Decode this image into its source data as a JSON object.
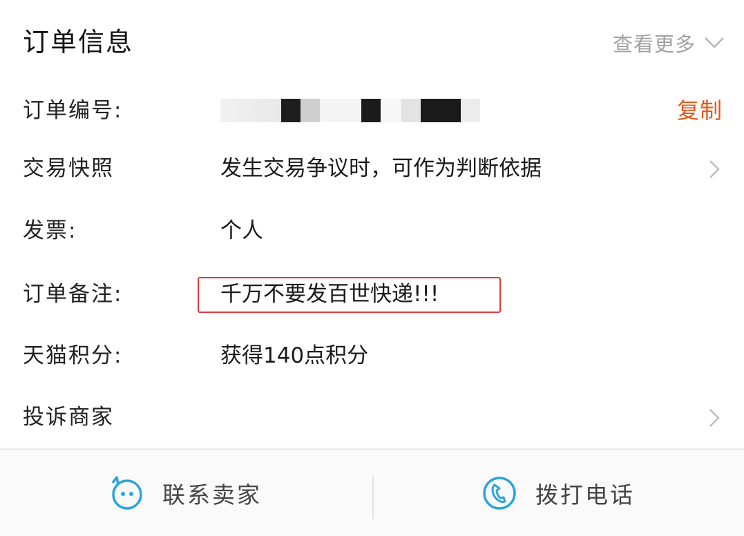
{
  "header": {
    "title": "订单信息",
    "more_label": "查看更多"
  },
  "rows": [
    {
      "label": "订单编号:",
      "action": "复制"
    },
    {
      "label": "交易快照",
      "value": "发生交易争议时，可作为判断依据"
    },
    {
      "label": "发票:",
      "value": "个人"
    },
    {
      "label": "订单备注:",
      "value": "千万不要发百世快递!!!"
    },
    {
      "label": "天猫积分:",
      "value": "获得140点积分"
    },
    {
      "label": "投诉商家"
    }
  ],
  "bottom": {
    "contact_seller": "联系卖家",
    "call_phone": "拨打电话"
  },
  "colors": {
    "accent": "#e5591d",
    "highlight_border": "#e23a3a",
    "icon_blue": "#2aa4dd"
  }
}
